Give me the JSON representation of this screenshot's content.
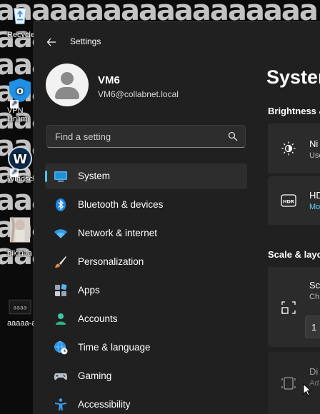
{
  "desktop": {
    "pattern_text": "aaaaaaaaaaaaaaaaaaaaaaaaaaaaaaaaaaaaaaaaaaaaaaaaaaaaaaaaaaaaaaaaaaaaaaaaaaaaaaaaaaaaaaaaaaaaaaaaaaaaaaaaaaaaaaaaaaaaaaaaaaaaaaaaaaaaaaaaaaaaaaaaaaaaaaaaaaaaaaaaaaaaaaaaaaaaaaaa",
    "icons": [
      {
        "label": "Recycle",
        "icon": "recycle-bin-icon"
      },
      {
        "label": "VPN Unlimi",
        "line1": "VPN",
        "line2": "Unlimi",
        "icon": "vpn-shield-icon"
      },
      {
        "label": "Windsc",
        "icon": "windscribe-icon"
      },
      {
        "label": "bikini-a",
        "icon": "image-file-icon"
      },
      {
        "label": "aaaaa-a",
        "icon": "image-file-icon"
      }
    ]
  },
  "window": {
    "title": "Settings",
    "profile": {
      "name": "VM6",
      "email": "VM6@collabnet.local"
    },
    "search": {
      "placeholder": "Find a setting"
    },
    "nav": [
      {
        "label": "System",
        "icon": "system-monitor-icon",
        "active": true
      },
      {
        "label": "Bluetooth & devices",
        "icon": "bluetooth-icon"
      },
      {
        "label": "Network & internet",
        "icon": "wifi-icon"
      },
      {
        "label": "Personalization",
        "icon": "brush-icon"
      },
      {
        "label": "Apps",
        "icon": "apps-icon"
      },
      {
        "label": "Accounts",
        "icon": "person-icon"
      },
      {
        "label": "Time & language",
        "icon": "globe-clock-icon"
      },
      {
        "label": "Gaming",
        "icon": "gamepad-icon"
      },
      {
        "label": "Accessibility",
        "icon": "accessibility-icon"
      }
    ],
    "content": {
      "title": "Syster",
      "section_brightness": "Brightness &",
      "night_light_title": "Ni",
      "night_light_sub": "Use",
      "hdr_title": "HD",
      "hdr_sub": "Mo",
      "section_scale": "Scale & layo",
      "scale_title": "Sc",
      "scale_sub": "Ch",
      "scale_value": "1",
      "display_title": "Di",
      "display_sub": "Ad"
    }
  },
  "colors": {
    "accent": "#4cc2ff",
    "window_bg": "#202020",
    "card_bg": "#2b2b2b"
  }
}
